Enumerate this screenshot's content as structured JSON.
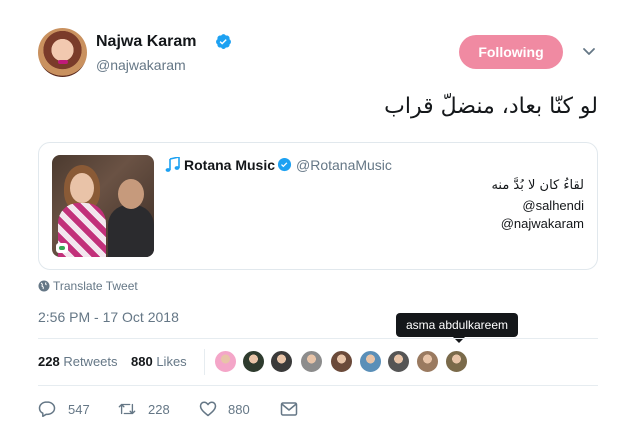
{
  "author": {
    "name": "Najwa Karam",
    "handle": "@najwakaram",
    "verified": true
  },
  "follow_button": {
    "label": "Following",
    "color": "#f08aa2"
  },
  "tweet": {
    "text": "لو كنّا بعاد، منضلّ قراب",
    "timestamp": "2:56 PM - 17 Oct 2018",
    "translate_label": "Translate Tweet"
  },
  "quoted_tweet": {
    "name": "Rotana Music",
    "handle": "@RotanaMusic",
    "verified": true,
    "lines": [
      "لقاءُ كان لا بُدَّ منه",
      "@salhendi",
      "@najwakaram"
    ]
  },
  "stats": {
    "retweets_count": "228",
    "retweets_label": "Retweets",
    "likes_count": "880",
    "likes_label": "Likes"
  },
  "tooltip": {
    "text": "asma abdulkareem"
  },
  "actions": {
    "replies": "547",
    "retweets": "228",
    "likes": "880"
  },
  "likers": [
    {
      "name": "liker-1",
      "color": "#f4a6c8"
    },
    {
      "name": "liker-2",
      "color": "#2e3b2e"
    },
    {
      "name": "liker-3",
      "color": "#3a3a3a"
    },
    {
      "name": "liker-4",
      "color": "#8c8c8c"
    },
    {
      "name": "liker-5",
      "color": "#6b4a3a"
    },
    {
      "name": "liker-6",
      "color": "#5a8fb8"
    },
    {
      "name": "liker-7",
      "color": "#555555"
    },
    {
      "name": "liker-8",
      "color": "#9a7a60"
    },
    {
      "name": "liker-9",
      "color": "#7a6a4a"
    }
  ],
  "colors": {
    "accent_blue": "#1da1f2",
    "muted_text": "#657786",
    "like_pink": "#f08aa2"
  }
}
